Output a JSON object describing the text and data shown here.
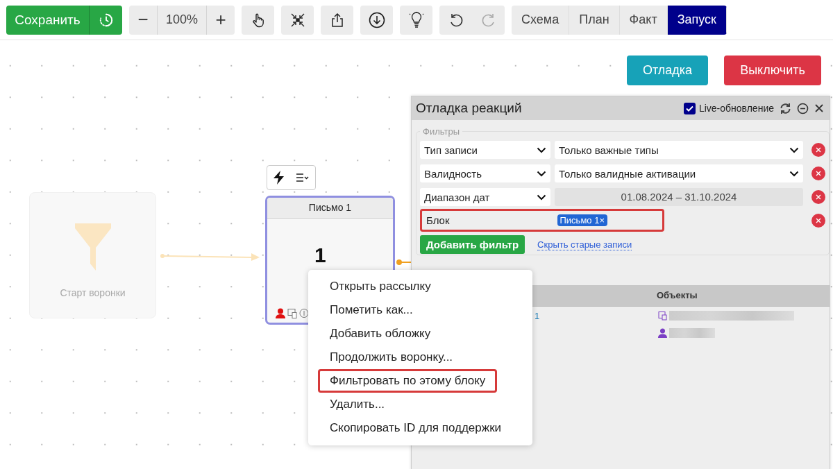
{
  "toolbar": {
    "save_label": "Сохранить",
    "zoom_out": "−",
    "zoom": "100%",
    "zoom_in": "+",
    "modes": [
      {
        "label": "Схема",
        "selected": false
      },
      {
        "label": "План",
        "selected": false
      },
      {
        "label": "Факт",
        "selected": false
      },
      {
        "label": "Запуск",
        "selected": true
      }
    ]
  },
  "actions": [
    {
      "label": "Отладка",
      "kind": "info"
    },
    {
      "label": "Выключить",
      "kind": "danger"
    }
  ],
  "canvas": {
    "start_node": {
      "label": "Старт воронки"
    },
    "email_node": {
      "title": "Письмо 1",
      "count": "1",
      "selected": true
    }
  },
  "debug_panel": {
    "title": "Отладка реакций",
    "live_update": {
      "label": "Live-обновление",
      "checked": true
    },
    "filters_legend": "Фильтры",
    "filters": [
      {
        "kind": "select",
        "field": "Тип записи",
        "value": "Только важные типы"
      },
      {
        "kind": "select",
        "field": "Валидность",
        "value": "Только валидные активации"
      },
      {
        "kind": "range",
        "field": "Диапазон дат",
        "value": "01.08.2024 – 31.10.2024"
      },
      {
        "kind": "tags",
        "field": "Блок",
        "tags": [
          {
            "label": "Письмо 1",
            "remove": "×"
          }
        ],
        "highlighted": true
      }
    ],
    "add_filter": "Добавить фильтр",
    "hide_old": "Скрыть старые записи",
    "table": {
      "objects_header": "Объекты",
      "rows": [
        {
          "column_1": "1",
          "objects": [
            {
              "kind": "document"
            },
            {
              "kind": "person"
            }
          ]
        }
      ]
    }
  },
  "context_menu": {
    "items": [
      {
        "label": "Открыть рассылку",
        "highlighted": false
      },
      {
        "label": "Пометить как...",
        "highlighted": false
      },
      {
        "label": "Добавить обложку",
        "highlighted": false
      },
      {
        "label": "Продолжить воронку...",
        "highlighted": false
      },
      {
        "label": "Фильтровать по этому блоку",
        "highlighted": true
      },
      {
        "label": "Удалить...",
        "highlighted": false
      },
      {
        "label": "Скопировать ID для поддержки",
        "highlighted": false
      }
    ]
  }
}
